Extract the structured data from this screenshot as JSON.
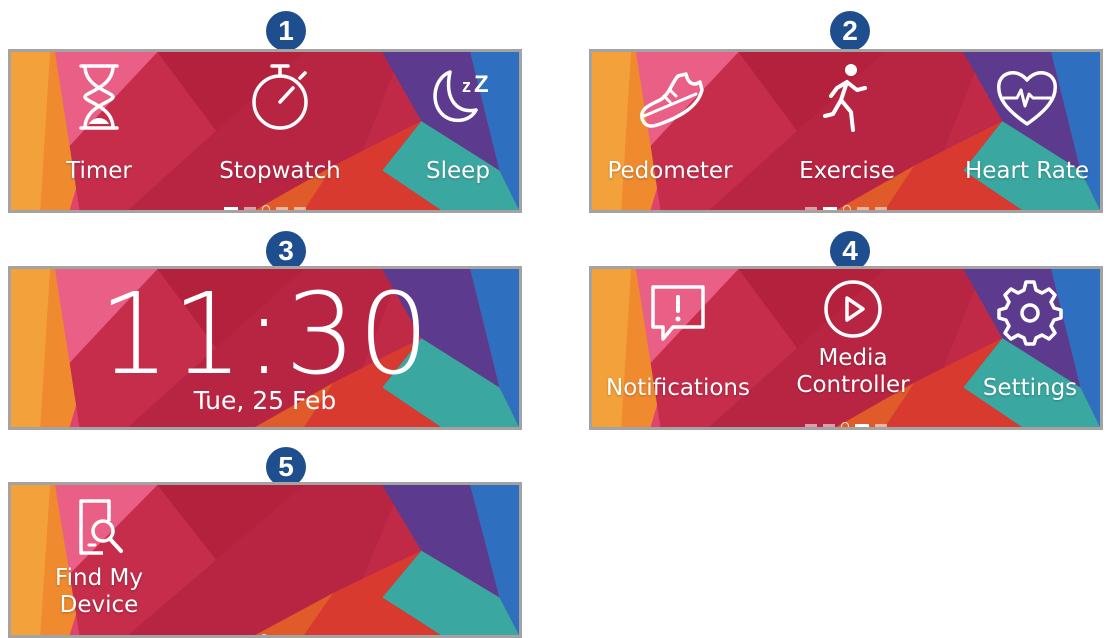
{
  "badges": [
    "1",
    "2",
    "3",
    "4",
    "5"
  ],
  "screen1": {
    "apps": [
      {
        "label": "Timer",
        "icon": "hourglass-icon"
      },
      {
        "label": "Stopwatch",
        "icon": "stopwatch-icon"
      },
      {
        "label": "Sleep",
        "icon": "sleep-moon-icon"
      }
    ],
    "active_page": 1
  },
  "screen2": {
    "apps": [
      {
        "label": "Pedometer",
        "icon": "shoe-icon"
      },
      {
        "label": "Exercise",
        "icon": "runner-icon"
      },
      {
        "label": "Heart Rate",
        "icon": "heart-rate-icon"
      }
    ],
    "active_page": 2
  },
  "screen3": {
    "time": "11:30",
    "date": "Tue, 25 Feb"
  },
  "screen4": {
    "apps": [
      {
        "label": "Notifications",
        "icon": "notification-bubble-icon"
      },
      {
        "label": "Media",
        "label2": "Controller",
        "icon": "play-icon"
      },
      {
        "label": "Settings",
        "icon": "gear-icon"
      }
    ],
    "active_page": 4
  },
  "screen5": {
    "apps": [
      {
        "label": "Find My",
        "label2": "Device",
        "icon": "find-device-icon"
      }
    ],
    "active_page": 5
  },
  "colors": {
    "badge": "#1f4e8f",
    "frame": "#a3a3a3",
    "wallpaper_main": "#c02a47"
  }
}
